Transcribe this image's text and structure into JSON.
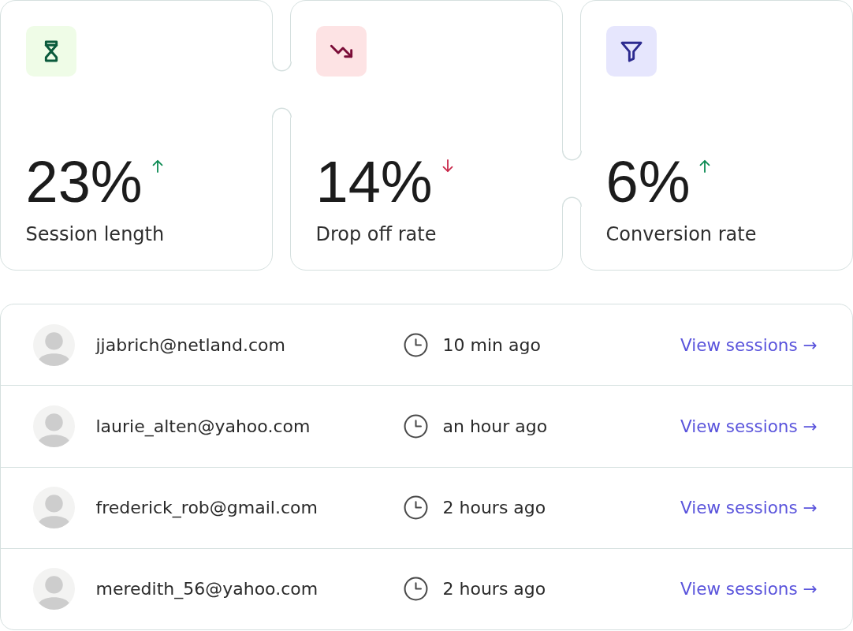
{
  "stats": [
    {
      "kind": "duration",
      "value": "23%",
      "rising": true,
      "label": "Session length"
    },
    {
      "kind": "dropoff",
      "value": "14%",
      "rising": false,
      "label": "Drop off rate"
    },
    {
      "kind": "conversion",
      "value": "6%",
      "rising": true,
      "label": "Conversion rate"
    }
  ],
  "sessions": [
    {
      "email": "jjabrich@netland.com",
      "time": "10 min ago",
      "link": "View sessions →"
    },
    {
      "email": "laurie_alten@yahoo.com",
      "time": "an hour ago",
      "link": "View sessions →"
    },
    {
      "email": "frederick_rob@gmail.com",
      "time": "2 hours ago",
      "link": "View sessions →"
    },
    {
      "email": "meredith_56@yahoo.com",
      "time": "2 hours ago",
      "link": "View sessions →"
    }
  ]
}
